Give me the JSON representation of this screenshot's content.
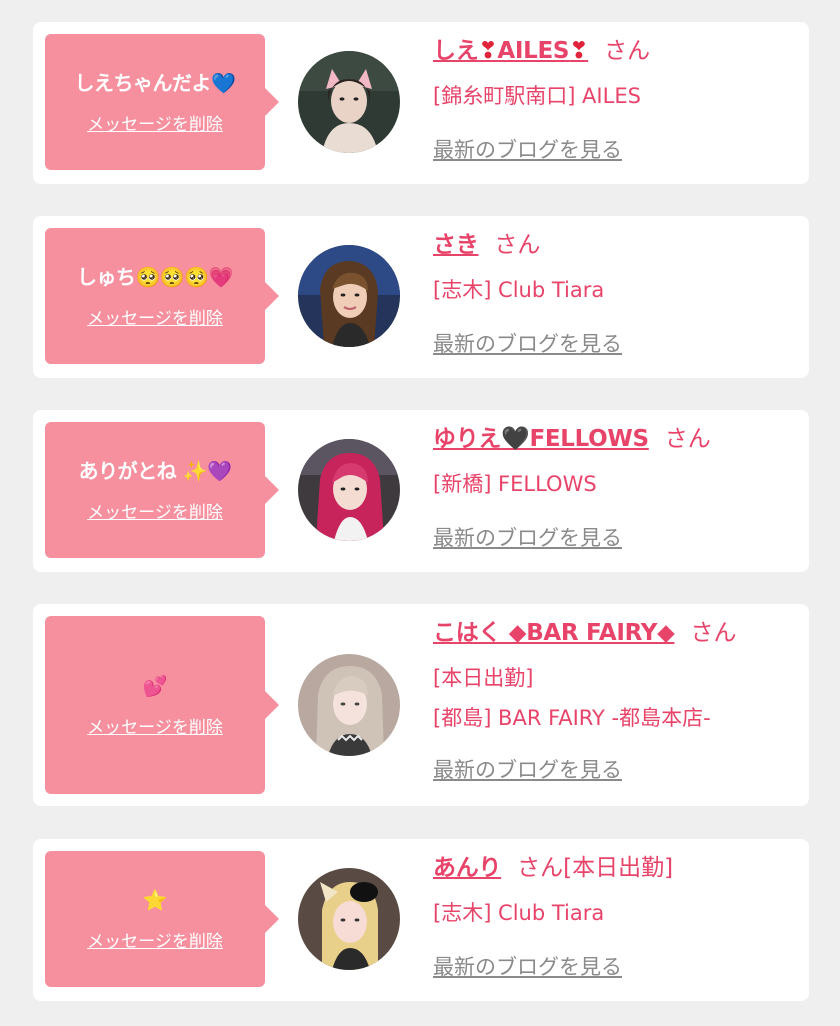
{
  "delete_label": "メッセージを削除",
  "blog_label": "最新のブログを見る",
  "honorific": "さん",
  "cards": [
    {
      "message_text": "しえちゃんだよ",
      "message_emoji": "💙",
      "name_pre": "しえ",
      "name_mid": "AILES",
      "name_sym": "❣",
      "shop_lines": [
        "[錦糸町駅南口] AILES"
      ]
    },
    {
      "message_text": "しゅち",
      "message_emoji": "🥺🥺🥺💗",
      "name": "さき",
      "shop_lines": [
        "[志木] Club Tiara"
      ]
    },
    {
      "message_text": "ありがとね",
      "message_emoji": "✨💜",
      "name_pre": "ゆりえ",
      "name_sym": "🖤",
      "name_post": "FELLOWS",
      "shop_lines": [
        "[新橋] FELLOWS"
      ]
    },
    {
      "message_emoji": "💕",
      "name": "こはく ◆BAR FAIRY◆",
      "shop_lines": [
        "[本日出勤]",
        "[都島] BAR FAIRY -都島本店-"
      ]
    },
    {
      "message_emoji": "⭐",
      "name": "あんり",
      "name_suffix": "[本日出勤]",
      "shop_lines": [
        "[志木] Club Tiara"
      ]
    }
  ],
  "colors": {
    "bubble": "#f6909e",
    "accent": "#e8446a",
    "link_gray": "#8a8a8a",
    "background": "#efefef"
  }
}
